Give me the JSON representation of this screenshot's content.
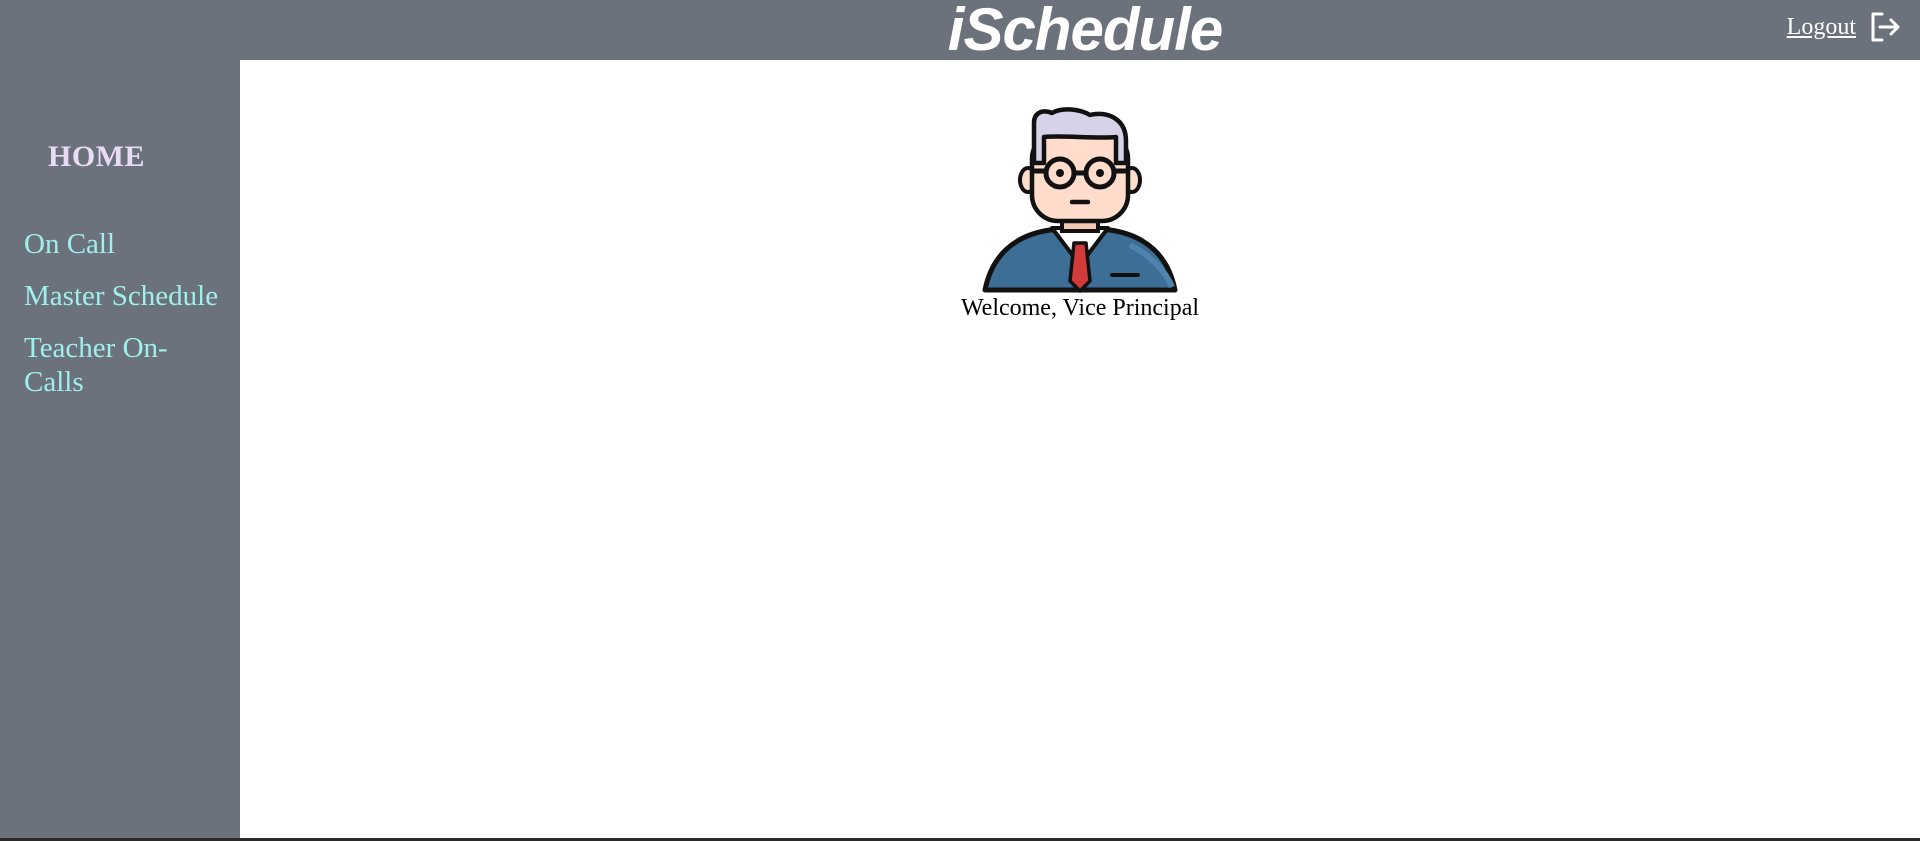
{
  "header": {
    "title": "iSchedule",
    "logout_label": "Logout",
    "logout_icon": "logout-icon"
  },
  "sidebar": {
    "home_label": "HOME",
    "items": [
      {
        "label": "On Call"
      },
      {
        "label": "Master Schedule"
      },
      {
        "label": "Teacher On-Calls"
      }
    ]
  },
  "main": {
    "avatar_icon": "vice-principal-avatar",
    "welcome_text": "Welcome, Vice Principal"
  },
  "colors": {
    "bar_bg": "#6c727c",
    "home_text": "#e8dcf4",
    "nav_link": "#9ff0ea",
    "suit": "#3d6e96",
    "hair": "#d6d3e8",
    "skin": "#ffdccb",
    "tie": "#d33b3b"
  }
}
